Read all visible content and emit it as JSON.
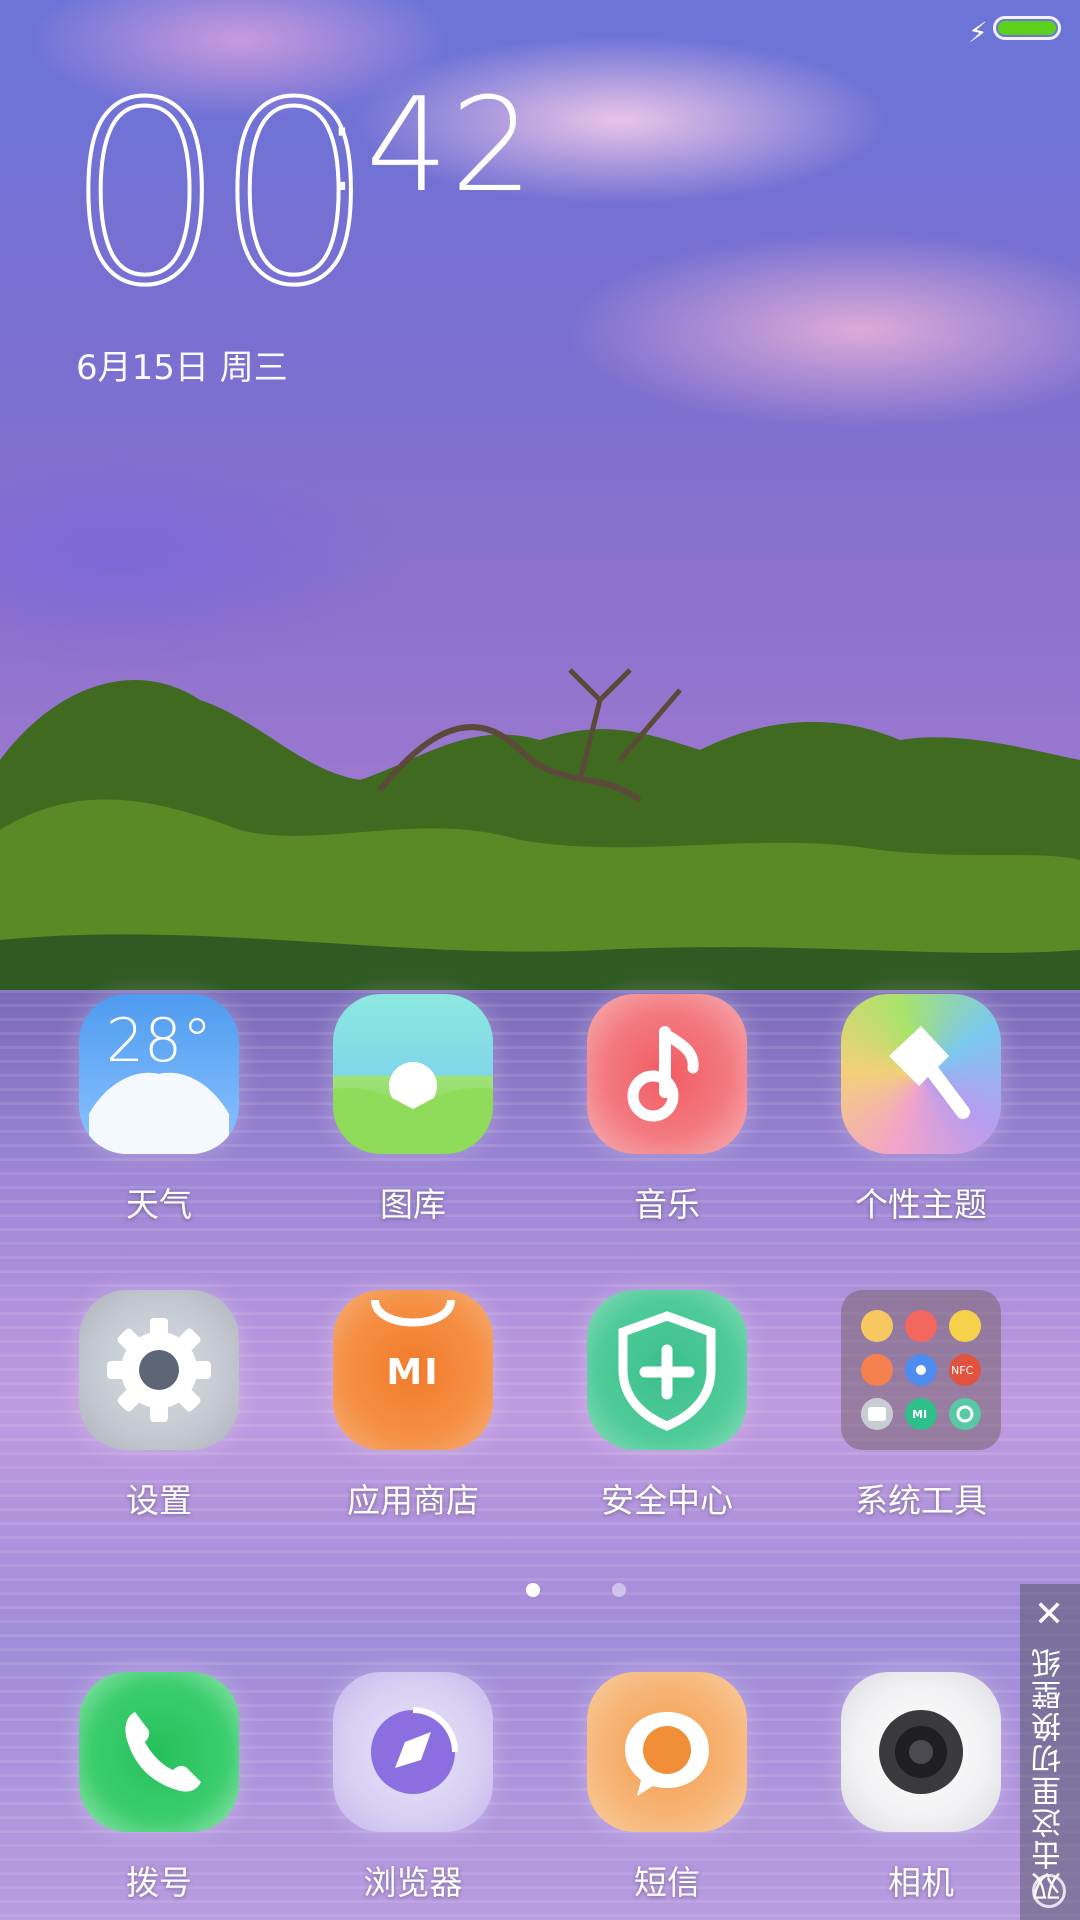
{
  "clock": {
    "hours": "00",
    "minutes": ":42"
  },
  "date": "6月15日 周三",
  "weather": {
    "temp": "28°"
  },
  "apps_row1": [
    {
      "label": "天气"
    },
    {
      "label": "图库"
    },
    {
      "label": "音乐"
    },
    {
      "label": "个性主题"
    }
  ],
  "apps_row2": [
    {
      "label": "设置"
    },
    {
      "label": "应用商店",
      "icon_text": "MI"
    },
    {
      "label": "安全中心"
    },
    {
      "label": "系统工具",
      "folder_badge": "NFC",
      "folder_mi": "MI"
    }
  ],
  "dock": [
    {
      "label": "拨号"
    },
    {
      "label": "浏览器"
    },
    {
      "label": "短信"
    },
    {
      "label": "相机"
    }
  ],
  "side_panel": {
    "text": "双击这里切换壁纸",
    "close": "✕"
  },
  "colors": {
    "battery": "#5bd11c"
  },
  "page_indicator": {
    "current": 1,
    "total": 2
  }
}
